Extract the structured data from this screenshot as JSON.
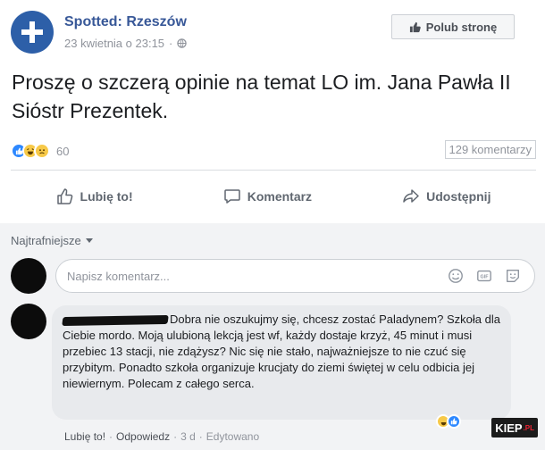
{
  "header": {
    "page_name": "Spotted: Rzeszów",
    "timestamp": "23 kwietnia o 23:15",
    "separator": "·",
    "like_page_label": "Polub stronę"
  },
  "post": {
    "text": "Proszę o szczerą opinie na temat LO im. Jana Pawła II Sióstr Prezentek."
  },
  "stats": {
    "reactions_count": "60",
    "comments_count": "129 komentarzy"
  },
  "actions": {
    "like": "Lubię to!",
    "comment": "Komentarz",
    "share": "Udostępnij"
  },
  "comments": {
    "sort_label": "Najtrafniejsze",
    "composer_placeholder": "Napisz komentarz...",
    "items": [
      {
        "text": "Dobra nie oszukujmy się, chcesz zostać Paladynem? Szkoła dla Ciebie mordo. Moją ulubioną lekcją jest wf, każdy dostaje krzyż, 45 minut i musi przebiec 13 stacji, nie zdążysz? Nic się nie stało, najważniejsze to nie czuć się przybitym. Ponadto szkoła organizuje krucjaty do ziemi świętej w celu odbicia jej niewiernym. Polecam z całego serca.",
        "like_label": "Lubię to!",
        "reply_label": "Odpowiedz",
        "time": "3 d",
        "edited_label": "Edytowano",
        "dot": "·"
      }
    ]
  },
  "watermark": {
    "brand": "KIEP",
    "suffix": ".PL"
  },
  "colors": {
    "link": "#385898",
    "muted": "#90949c",
    "comment_bg": "#e8eaed",
    "area_bg": "#f2f3f5"
  }
}
